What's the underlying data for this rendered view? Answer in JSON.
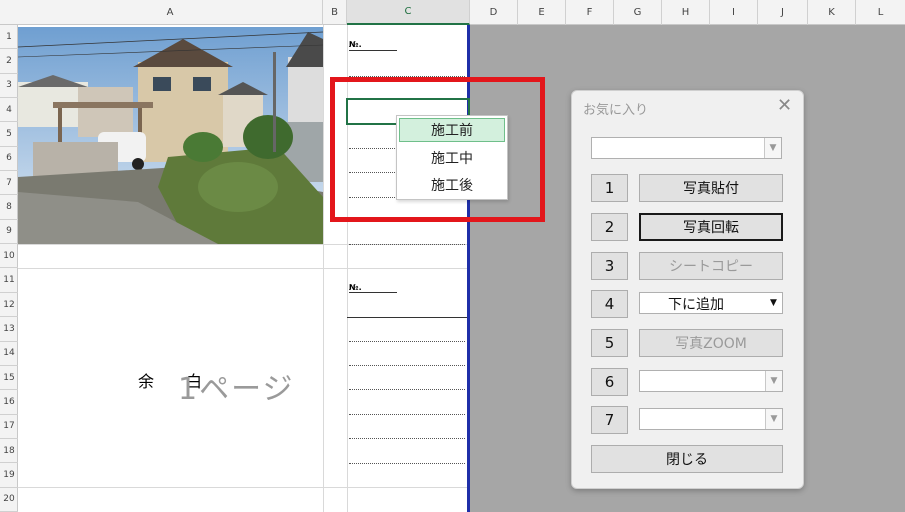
{
  "sheet": {
    "columns": [
      "A",
      "B",
      "C",
      "D",
      "E",
      "F",
      "G",
      "H",
      "I",
      "J",
      "K",
      "L"
    ],
    "rows": [
      "1",
      "2",
      "3",
      "4",
      "5",
      "6",
      "7",
      "8",
      "9",
      "10",
      "11",
      "12",
      "13",
      "14",
      "15",
      "16",
      "17",
      "18",
      "19",
      "20"
    ],
    "no_label_1": "№.",
    "no_label_2": "№.",
    "margin_text_1": "余",
    "margin_text_2": "白",
    "page_watermark": "1ページ"
  },
  "dropdown": {
    "items": [
      "施工前",
      "施工中",
      "施工後"
    ],
    "highlighted_index": 0
  },
  "dialog": {
    "title": "お気に入り",
    "close": "✕",
    "top_combo_value": "",
    "numbers": [
      "1",
      "2",
      "3",
      "4",
      "5",
      "6",
      "7"
    ],
    "buttons": {
      "b1": "写真貼付",
      "b2": "写真回転",
      "b3": "シートコピー",
      "b4_combo": "下に追加",
      "b5": "写真ZOOM",
      "b6_combo": "",
      "b7_combo": ""
    },
    "close_button": "閉じる"
  },
  "colors": {
    "accent_green": "#217346",
    "sheet_border_blue": "#1f2fa8",
    "highlight_red": "#e3161b"
  }
}
